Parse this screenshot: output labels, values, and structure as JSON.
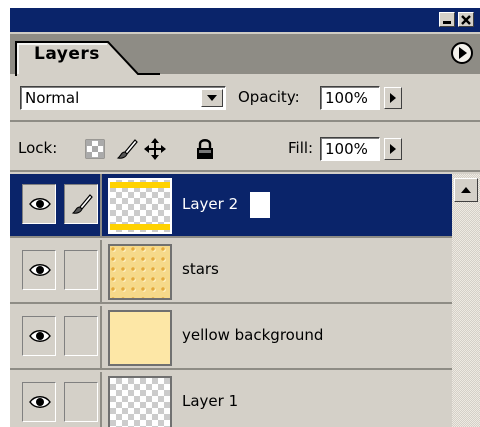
{
  "panel": {
    "tab_label": "Layers"
  },
  "blend": {
    "mode": "Normal",
    "opacity_label": "Opacity:",
    "opacity_value": "100%"
  },
  "lock": {
    "label": "Lock:",
    "fill_label": "Fill:",
    "fill_value": "100%"
  },
  "layers": [
    {
      "name": "Layer 2",
      "selected": true,
      "visible": true,
      "thumbnail": "transparent-with-yellow-bars"
    },
    {
      "name": "stars",
      "selected": false,
      "visible": true,
      "thumbnail": "stars-pattern"
    },
    {
      "name": "yellow background",
      "selected": false,
      "visible": true,
      "thumbnail": "solid-yellow"
    },
    {
      "name": "Layer 1",
      "selected": false,
      "visible": true,
      "thumbnail": "transparent"
    }
  ],
  "colors": {
    "titlebar": "#0a246a",
    "selection": "#0a246a",
    "panel_bg": "#d4d0c8",
    "accent_yellow": "#ffd200"
  },
  "icons": [
    "minimize-icon",
    "close-icon",
    "panel-menu-icon",
    "dropdown-arrow-icon",
    "lock-transparency-icon",
    "lock-brush-icon",
    "lock-move-icon",
    "lock-all-icon",
    "eye-icon",
    "brush-link-icon",
    "scroll-up-icon"
  ]
}
